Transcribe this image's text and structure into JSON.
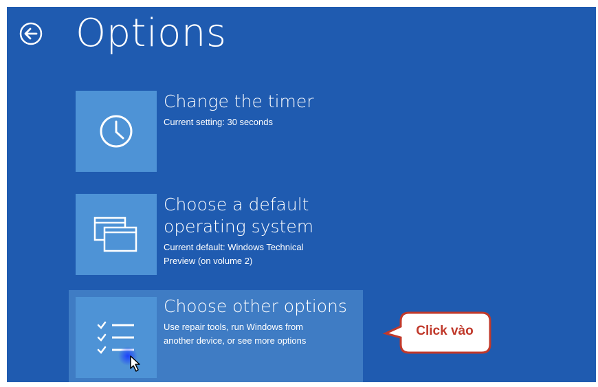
{
  "page": {
    "title": "Options"
  },
  "options": [
    {
      "icon": "clock-icon",
      "heading_lines": [
        "Change the timer"
      ],
      "desc_lines": [
        "Current setting: 30 seconds"
      ]
    },
    {
      "icon": "windows-stack-icon",
      "heading_lines": [
        "Choose a default",
        "operating system"
      ],
      "desc_lines": [
        "Current default: Windows Technical",
        "Preview (on volume 2)"
      ]
    },
    {
      "icon": "checklist-icon",
      "heading_lines": [
        "Choose other options"
      ],
      "desc_lines": [
        "Use repair tools, run Windows from",
        "another device, or see more options"
      ]
    }
  ],
  "callout": {
    "label": "Click vào",
    "color": "#c0392b"
  },
  "colors": {
    "background": "#1f5bb0",
    "tile": "#4e93d6",
    "selected": "#3f7cc4"
  }
}
